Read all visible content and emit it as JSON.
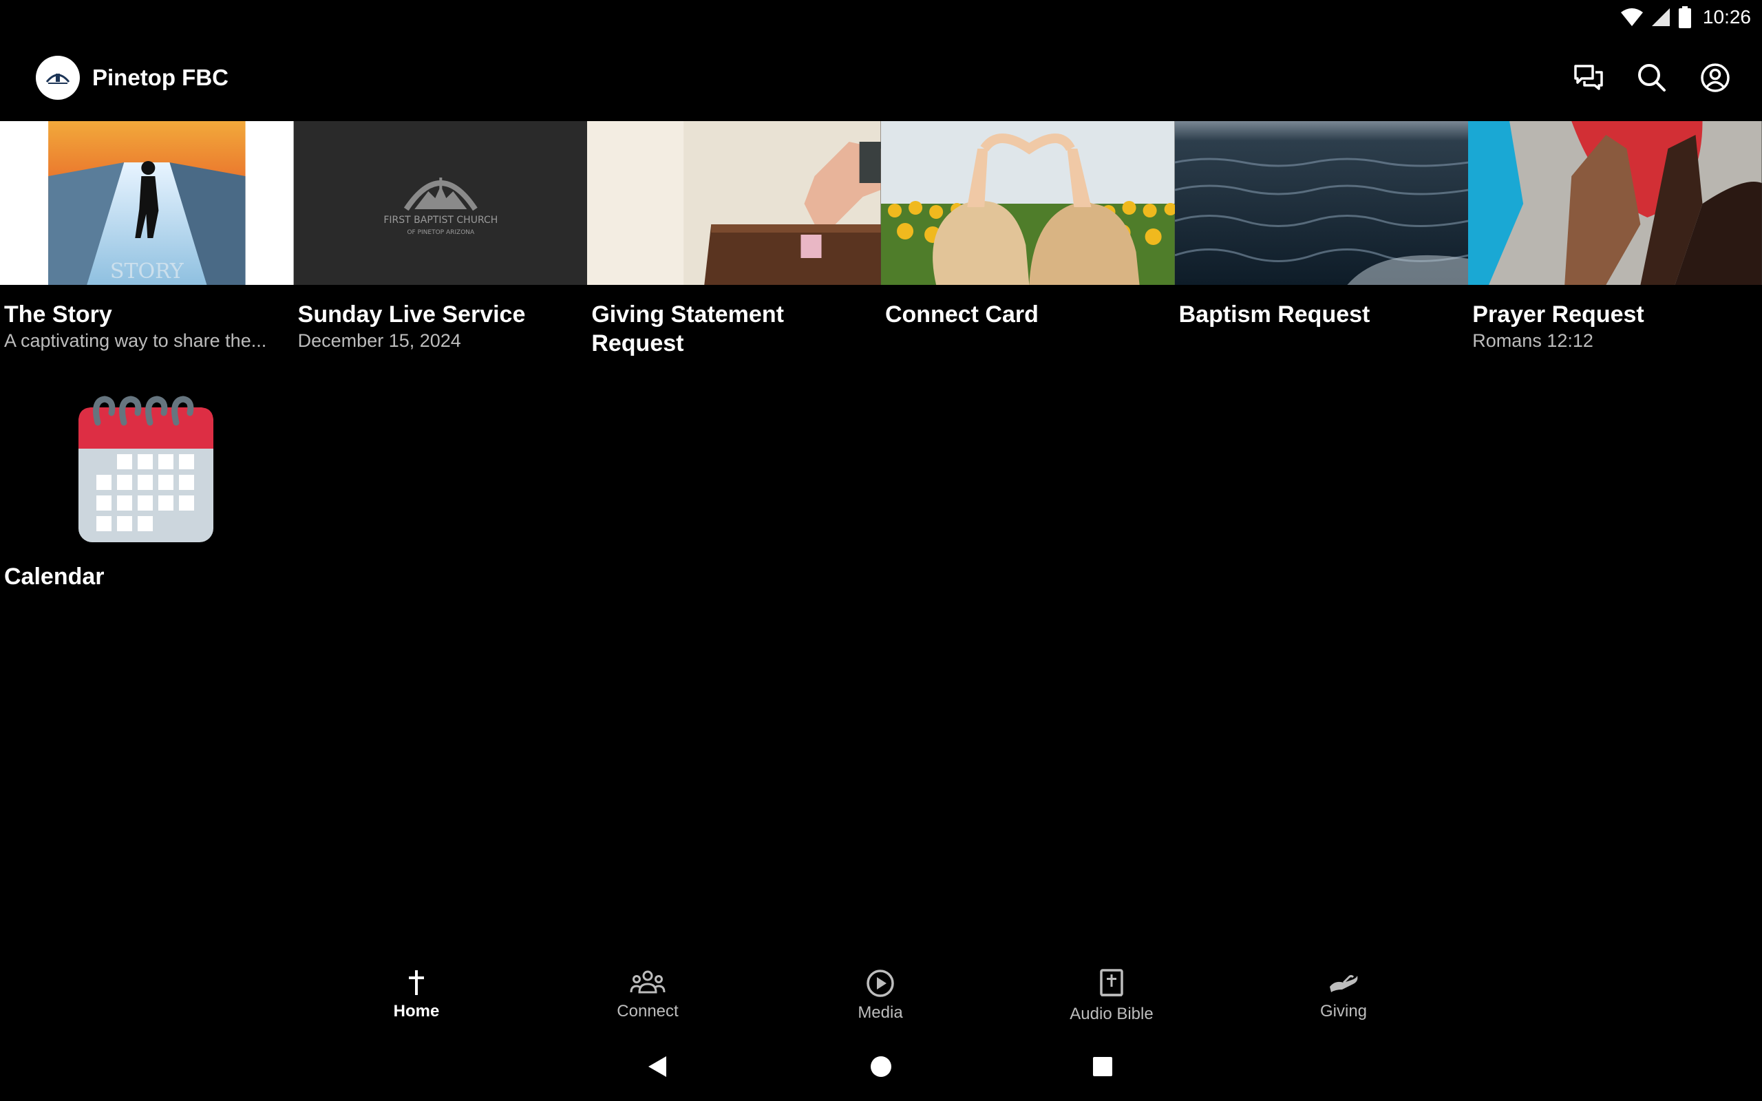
{
  "status": {
    "time": "10:26"
  },
  "app": {
    "title": "Pinetop FBC"
  },
  "tiles": [
    {
      "title": "The Story",
      "subtitle": "A captivating way to share the..."
    },
    {
      "title": "Sunday Live Service",
      "subtitle": "December 15, 2024",
      "logo_line1": "FIRST BAPTIST CHURCH",
      "logo_line2": "OF PINETOP ARIZONA"
    },
    {
      "title": "Giving Statement Request",
      "subtitle": ""
    },
    {
      "title": "Connect Card",
      "subtitle": ""
    },
    {
      "title": "Baptism Request",
      "subtitle": ""
    },
    {
      "title": "Prayer Request",
      "subtitle": "Romans 12:12"
    }
  ],
  "calendar": {
    "title": "Calendar"
  },
  "nav": [
    {
      "label": "Home",
      "icon": "cross-icon",
      "active": true
    },
    {
      "label": "Connect",
      "icon": "group-icon",
      "active": false
    },
    {
      "label": "Media",
      "icon": "play-circle-icon",
      "active": false
    },
    {
      "label": "Audio Bible",
      "icon": "bible-icon",
      "active": false
    },
    {
      "label": "Giving",
      "icon": "hand-icon",
      "active": false
    }
  ],
  "colors": {
    "background": "#000000",
    "text": "#ffffff",
    "muted": "#bdbdbd",
    "calendar_red": "#e0283f"
  }
}
